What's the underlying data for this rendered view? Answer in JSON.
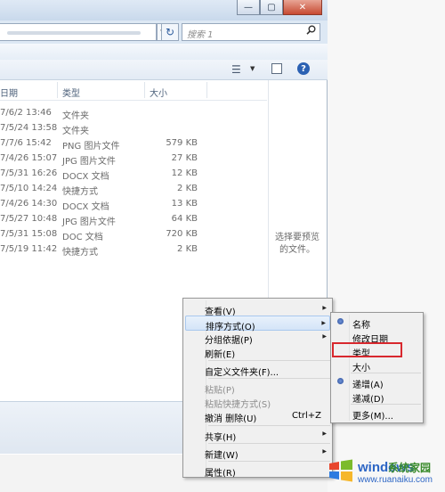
{
  "window": {
    "controls": {
      "minimize": "—",
      "maximize": "▢",
      "close": "✕"
    },
    "address": {
      "dropdown": "▼",
      "refresh": "↻"
    },
    "search": {
      "placeholder": "搜索 1",
      "icon": "search-icon"
    }
  },
  "toolbar": {
    "view_icon": "view-options-icon",
    "help": "?"
  },
  "columns": {
    "date": "日期",
    "type": "类型",
    "size": "大小"
  },
  "files": [
    {
      "date": "7/6/2 13:46",
      "type": "文件夹",
      "size": ""
    },
    {
      "date": "7/5/24 13:58",
      "type": "文件夹",
      "size": ""
    },
    {
      "date": "7/7/6 15:42",
      "type": "PNG 图片文件",
      "size": "579 KB"
    },
    {
      "date": "7/4/26 15:07",
      "type": "JPG 图片文件",
      "size": "27 KB"
    },
    {
      "date": "7/5/31 16:26",
      "type": "DOCX 文档",
      "size": "12 KB"
    },
    {
      "date": "7/5/10 14:24",
      "type": "快捷方式",
      "size": "2 KB"
    },
    {
      "date": "7/4/26 14:30",
      "type": "DOCX 文档",
      "size": "13 KB"
    },
    {
      "date": "7/5/27 10:48",
      "type": "JPG 图片文件",
      "size": "64 KB"
    },
    {
      "date": "7/5/31 15:08",
      "type": "DOC 文档",
      "size": "720 KB"
    },
    {
      "date": "7/5/19 11:42",
      "type": "快捷方式",
      "size": "2 KB"
    }
  ],
  "preview": {
    "line1": "选择要预览",
    "line2": "的文件。"
  },
  "context_menu": {
    "view": "查看(V)",
    "sort": "排序方式(O)",
    "group": "分组依据(P)",
    "refresh": "刷新(E)",
    "customize": "自定义文件夹(F)...",
    "paste": "粘贴(P)",
    "paste_shortcut": "粘贴快捷方式(S)",
    "undo_delete": "撤消 删除(U)",
    "undo_shortcut": "Ctrl+Z",
    "share": "共享(H)",
    "new": "新建(W)",
    "properties": "属性(R)"
  },
  "sort_menu": {
    "name": "名称",
    "modified": "修改日期",
    "type": "类型",
    "size": "大小",
    "ascending": "递增(A)",
    "descending": "递减(D)",
    "more": "更多(M)..."
  },
  "watermark": {
    "brand": "windows",
    "suffix": "系统家园",
    "url": "www.ruanaiku.com"
  },
  "colors": {
    "highlight_box": "#d8282e",
    "accent": "#2d66c5"
  }
}
